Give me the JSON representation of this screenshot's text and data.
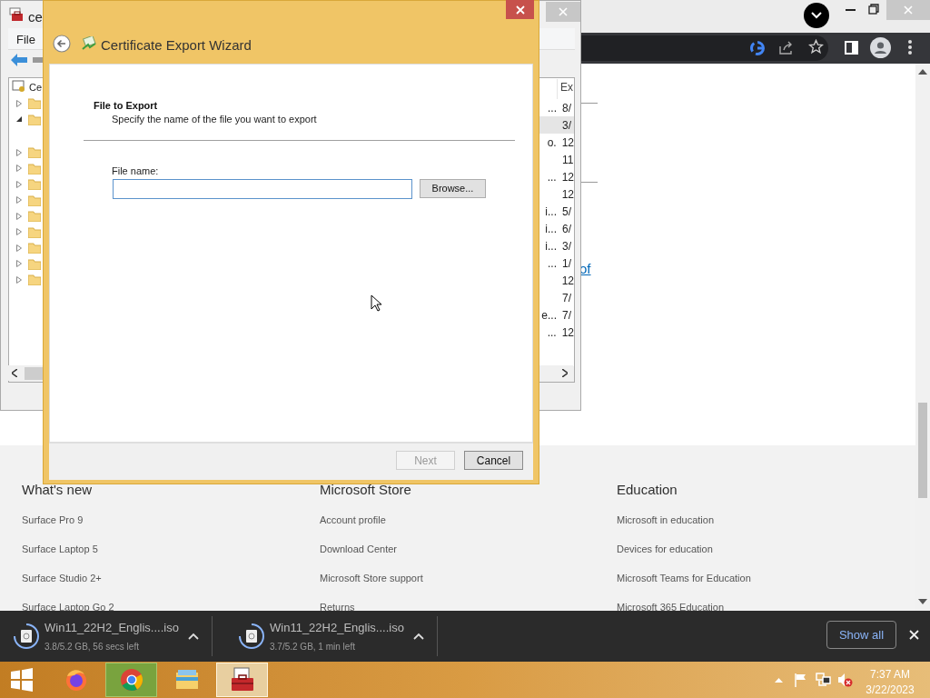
{
  "page": {
    "partial_link": "of",
    "footer_columns": [
      {
        "heading": "What's new",
        "links": [
          "Surface Pro 9",
          "Surface Laptop 5",
          "Surface Studio 2+",
          "Surface Laptop Go 2"
        ]
      },
      {
        "heading": "Microsoft Store",
        "links": [
          "Account profile",
          "Download Center",
          "Microsoft Store support",
          "Returns"
        ]
      },
      {
        "heading": "Education",
        "links": [
          "Microsoft in education",
          "Devices for education",
          "Microsoft Teams for Education",
          "Microsoft 365 Education"
        ]
      }
    ]
  },
  "console": {
    "title": "ce",
    "menu": [
      "File"
    ],
    "tree_root": "Ce",
    "tree": [
      {
        "expanded": false
      },
      {
        "expanded": true
      },
      {
        "expanded": false
      },
      {
        "expanded": false
      },
      {
        "expanded": false
      },
      {
        "expanded": false
      },
      {
        "expanded": false
      },
      {
        "expanded": false
      },
      {
        "expanded": false
      },
      {
        "expanded": false
      },
      {
        "expanded": false
      }
    ],
    "list": {
      "column": "Ex",
      "rows": [
        {
          "cells": [
            "...",
            "8/"
          ],
          "selected": false
        },
        {
          "cells": [
            "3/"
          ],
          "selected": true
        },
        {
          "cells": [
            "o.",
            "12"
          ],
          "selected": false
        },
        {
          "cells": [
            "11"
          ],
          "selected": false
        },
        {
          "cells": [
            "...",
            "12"
          ],
          "selected": false
        },
        {
          "cells": [
            "12"
          ],
          "selected": false
        },
        {
          "cells": [
            "i...",
            "5/"
          ],
          "selected": false
        },
        {
          "cells": [
            "i...",
            "6/"
          ],
          "selected": false
        },
        {
          "cells": [
            "i...",
            "3/"
          ],
          "selected": false
        },
        {
          "cells": [
            "...",
            "1/"
          ],
          "selected": false
        },
        {
          "cells": [
            "12"
          ],
          "selected": false
        },
        {
          "cells": [
            "7/"
          ],
          "selected": false
        },
        {
          "cells": [
            "e...",
            "7/"
          ],
          "selected": false
        },
        {
          "cells": [
            "...",
            "12"
          ],
          "selected": false
        }
      ]
    }
  },
  "wizard": {
    "title": "Certificate Export Wizard",
    "heading": "File to Export",
    "subheading": "Specify the name of the file you want to export",
    "field_label": "File name:",
    "browse": "Browse...",
    "buttons": [
      {
        "label": "Next",
        "disabled": true
      },
      {
        "label": "Cancel",
        "disabled": false
      }
    ]
  },
  "downloads": [
    {
      "name": "Win11_22H2_Englis....iso",
      "status": "3.8/5.2 GB, 56 secs left"
    },
    {
      "name": "Win11_22H2_Englis....iso",
      "status": "3.7/5.2 GB, 1 min left"
    }
  ],
  "show_all": "Show all",
  "taskbar": {
    "apps": [
      {
        "kind": "firefox",
        "selected": false
      },
      {
        "kind": "chrome",
        "selected": true
      },
      {
        "kind": "explorer",
        "selected": false
      },
      {
        "kind": "toolbox",
        "selected": true
      }
    ],
    "time": "7:37 AM",
    "date": "3/22/2023"
  }
}
